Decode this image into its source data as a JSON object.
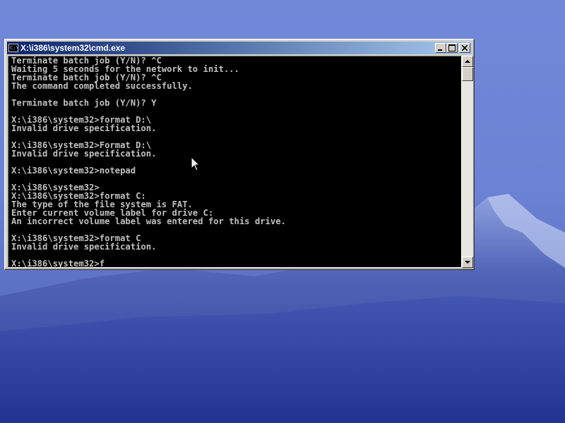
{
  "window": {
    "title": "X:\\i386\\system32\\cmd.exe",
    "icon_label": "C:\\"
  },
  "console": {
    "lines": [
      "Terminate batch job (Y/N)? ^C",
      "Waiting 5 seconds for the network to init...",
      "Terminate batch job (Y/N)? ^C",
      "The command completed successfully.",
      "",
      "Terminate batch job (Y/N)? Y",
      "",
      "X:\\i386\\system32>format D:\\",
      "Invalid drive specification.",
      "",
      "X:\\i386\\system32>Format D:\\",
      "Invalid drive specification.",
      "",
      "X:\\i386\\system32>notepad",
      "",
      "X:\\i386\\system32>",
      "X:\\i386\\system32>format C:",
      "The type of the file system is FAT.",
      "Enter current volume label for drive C:",
      "An incorrect volume label was entered for this drive.",
      "",
      "X:\\i386\\system32>format C",
      "Invalid drive specification.",
      "",
      "X:\\i386\\system32>f"
    ]
  },
  "icons": {
    "minimize": "minimize-icon",
    "maximize": "maximize-icon",
    "close": "close-icon",
    "scroll_up": "scroll-up-arrow-icon",
    "scroll_down": "scroll-down-arrow-icon",
    "cursor": "mouse-pointer-icon"
  },
  "colors": {
    "console_bg": "#000000",
    "console_text": "#c0c0c0",
    "titlebar_start": "#0a246a",
    "titlebar_end": "#a6caf0"
  }
}
